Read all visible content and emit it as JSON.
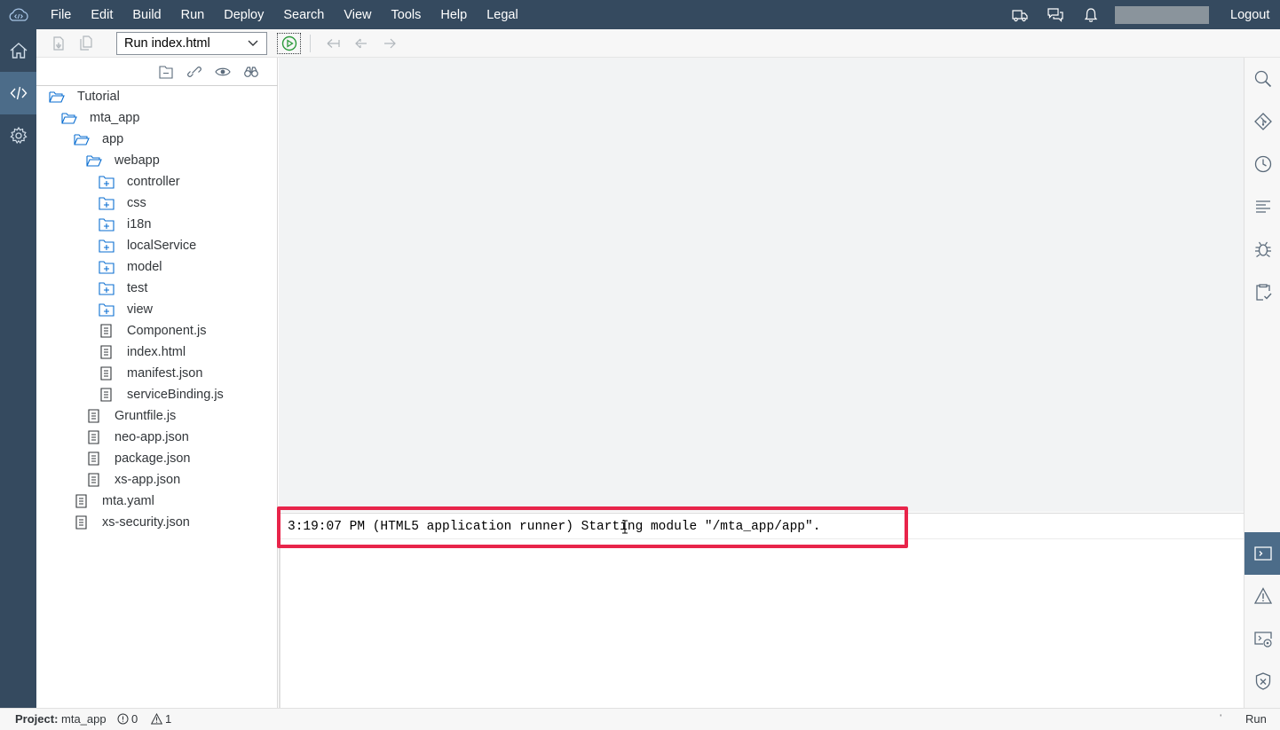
{
  "menubar": {
    "logo_icon": "cloud-code-icon",
    "items": [
      "File",
      "Edit",
      "Build",
      "Run",
      "Deploy",
      "Search",
      "View",
      "Tools",
      "Help",
      "Legal"
    ],
    "right_icons": [
      "delivery-truck-icon",
      "discussion-icon",
      "notification-bell-icon"
    ],
    "logout_label": "Logout"
  },
  "leftbar": {
    "items": [
      {
        "name": "home",
        "icon": "home-icon",
        "active": false
      },
      {
        "name": "development",
        "icon": "code-icon",
        "active": true
      },
      {
        "name": "preferences",
        "icon": "gear-icon",
        "active": false
      }
    ]
  },
  "toolbar": {
    "run_config_label": "Run index.html",
    "icons": [
      "save-icon",
      "save-all-icon",
      "run-icon",
      "undo-icon",
      "back-icon",
      "forward-icon"
    ]
  },
  "tree_tools": [
    "collapse-all-icon",
    "link-editor-icon",
    "show-hidden-icon",
    "search-binoculars-icon"
  ],
  "tree": [
    {
      "label": "Tutorial",
      "type": "folder-open",
      "depth": 0
    },
    {
      "label": "mta_app",
      "type": "folder-open",
      "depth": 1
    },
    {
      "label": "app",
      "type": "folder-open",
      "depth": 2
    },
    {
      "label": "webapp",
      "type": "folder-open",
      "depth": 3
    },
    {
      "label": "controller",
      "type": "folder-closed",
      "depth": 4
    },
    {
      "label": "css",
      "type": "folder-closed",
      "depth": 4
    },
    {
      "label": "i18n",
      "type": "folder-closed",
      "depth": 4
    },
    {
      "label": "localService",
      "type": "folder-closed",
      "depth": 4
    },
    {
      "label": "model",
      "type": "folder-closed",
      "depth": 4
    },
    {
      "label": "test",
      "type": "folder-closed",
      "depth": 4
    },
    {
      "label": "view",
      "type": "folder-closed",
      "depth": 4
    },
    {
      "label": "Component.js",
      "type": "file",
      "depth": 4
    },
    {
      "label": "index.html",
      "type": "file",
      "depth": 4
    },
    {
      "label": "manifest.json",
      "type": "file",
      "depth": 4
    },
    {
      "label": "serviceBinding.js",
      "type": "file",
      "depth": 4
    },
    {
      "label": "Gruntfile.js",
      "type": "file",
      "depth": 3
    },
    {
      "label": "neo-app.json",
      "type": "file",
      "depth": 3
    },
    {
      "label": "package.json",
      "type": "file",
      "depth": 3
    },
    {
      "label": "xs-app.json",
      "type": "file",
      "depth": 3
    },
    {
      "label": "mta.yaml",
      "type": "file",
      "depth": 2
    },
    {
      "label": "xs-security.json",
      "type": "file",
      "depth": 2
    }
  ],
  "console": {
    "message": "3:19:07 PM (HTML5 application runner) Starting module \"/mta_app/app\"."
  },
  "rightbar": {
    "top_icons": [
      "search-icon",
      "git-icon",
      "history-icon",
      "outline-icon",
      "debugger-icon",
      "code-check-icon"
    ],
    "bottom_icons": [
      {
        "icon": "console-icon",
        "active": true
      },
      {
        "icon": "problems-warning-icon",
        "active": false
      },
      {
        "icon": "run-console-icon",
        "active": false
      },
      {
        "icon": "security-shield-icon",
        "active": false
      }
    ]
  },
  "statusbar": {
    "project_label": "Project:",
    "project_name": "mta_app",
    "errors_count": "0",
    "warnings_count": "1",
    "run_label": "Run"
  },
  "colors": {
    "shell": "#354a5f",
    "active": "#4c6c89",
    "highlight": "#e8244a",
    "icon": "#0a6ed1"
  }
}
